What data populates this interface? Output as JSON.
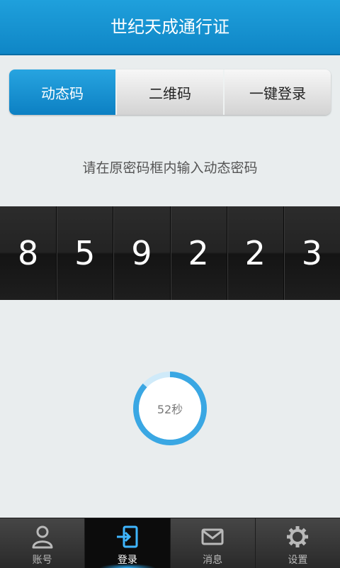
{
  "app_title": "世纪天成通行证",
  "tabs": [
    {
      "label": "动态码",
      "active": true
    },
    {
      "label": "二维码",
      "active": false
    },
    {
      "label": "一键登录",
      "active": false
    }
  ],
  "hint": "请在原密码框内输入动态密码",
  "code_digits": [
    "8",
    "5",
    "9",
    "2",
    "2",
    "3"
  ],
  "timer": {
    "label": "52秒",
    "remaining_seconds": 52,
    "total_seconds": 60
  },
  "nav": [
    {
      "label": "账号",
      "icon": "account-icon",
      "active": false
    },
    {
      "label": "登录",
      "icon": "login-icon",
      "active": true
    },
    {
      "label": "消息",
      "icon": "message-icon",
      "active": false
    },
    {
      "label": "设置",
      "icon": "settings-icon",
      "active": false
    }
  ],
  "colors": {
    "accent": "#1a93d3",
    "nav_bg": "#3a3a3a",
    "timer_ring": "#3aa7e3"
  }
}
